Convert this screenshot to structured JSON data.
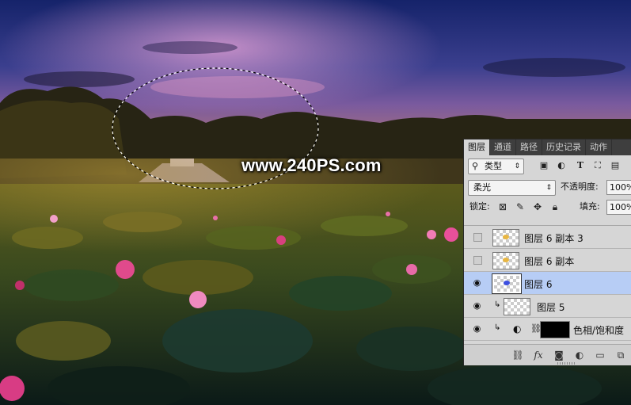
{
  "scene": {
    "watermark": "www.240PS.com"
  },
  "panel": {
    "tabs": [
      "图层",
      "通道",
      "路径",
      "历史记录",
      "动作"
    ],
    "filter": {
      "kind_label": "类型"
    },
    "filter_icons": [
      "image-filter-icon",
      "adjustment-filter-icon",
      "type-filter-icon",
      "shape-filter-icon",
      "smart-object-filter-icon"
    ],
    "blend_mode": "柔光",
    "opacity_label": "不透明度:",
    "opacity_value": "100%",
    "lock_label": "锁定:",
    "fill_label": "填充:",
    "fill_value": "100%",
    "layers": [
      {
        "name": "图层 6 副本 3",
        "visible": false,
        "selected": false
      },
      {
        "name": "图层 6 副本",
        "visible": false,
        "selected": false
      },
      {
        "name": "图层 6",
        "visible": true,
        "selected": true
      },
      {
        "name": "图层 5",
        "visible": true,
        "selected": false,
        "clipped": true
      },
      {
        "name": "色相/饱和度",
        "visible": true,
        "selected": false,
        "clipped": true,
        "adjustment": true
      }
    ],
    "colors": {
      "selection_highlight": "#b7cdf5",
      "panel_bg": "#d6d6d6",
      "tab_bar": "#3e3e3e"
    }
  }
}
